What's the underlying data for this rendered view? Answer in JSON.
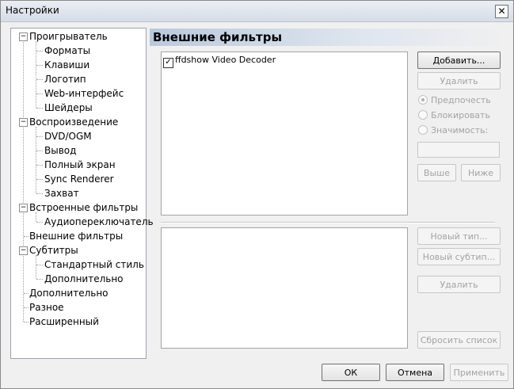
{
  "window": {
    "title": "Настройки"
  },
  "tree": {
    "items": [
      {
        "label": "Проигрыватель"
      },
      {
        "label": "Форматы"
      },
      {
        "label": "Клавиши"
      },
      {
        "label": "Логотип"
      },
      {
        "label": "Web-интерфейс"
      },
      {
        "label": "Шейдеры"
      },
      {
        "label": "Воспроизведение"
      },
      {
        "label": "DVD/OGM"
      },
      {
        "label": "Вывод"
      },
      {
        "label": "Полный экран"
      },
      {
        "label": "Sync Renderer"
      },
      {
        "label": "Захват"
      },
      {
        "label": "Встроенные фильтры"
      },
      {
        "label": "Аудиопереключатель"
      },
      {
        "label": "Внешние фильтры"
      },
      {
        "label": "Субтитры"
      },
      {
        "label": "Стандартный стиль"
      },
      {
        "label": "Дополнительно"
      },
      {
        "label": "Дополнительно"
      },
      {
        "label": "Разное"
      },
      {
        "label": "Расширенный"
      }
    ],
    "selected": "Внешние фильтры"
  },
  "panel": {
    "header": "Внешние фильтры",
    "filters": [
      {
        "name": "ffdshow Video Decoder",
        "checked": true
      }
    ],
    "buttons": {
      "add": "Добавить...",
      "remove": "Удалить",
      "up": "Выше",
      "down": "Ниже",
      "new_type": "Новый тип...",
      "new_subtype": "Новый субтип...",
      "remove2": "Удалить",
      "reset_list": "Сбросить список"
    },
    "options": {
      "prefer": "Предпочесть",
      "block": "Блокировать",
      "merit": "Значимость:"
    }
  },
  "footer": {
    "ok": "ОК",
    "cancel": "Отмена",
    "apply": "Применить"
  }
}
